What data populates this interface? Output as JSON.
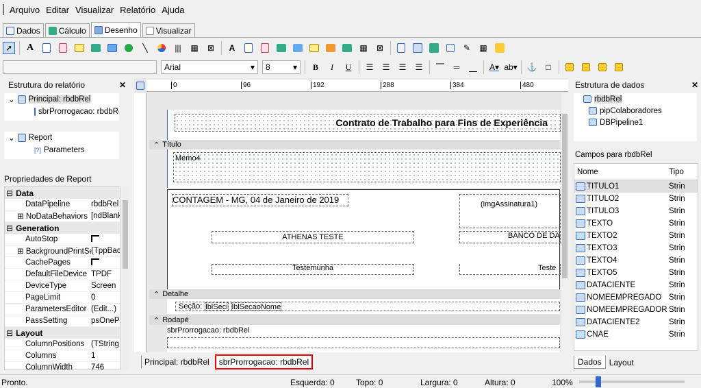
{
  "menu": [
    "Arquivo",
    "Editar",
    "Visualizar",
    "Relatório",
    "Ajuda"
  ],
  "tabs": [
    "Dados",
    "Cálculo",
    "Desenho",
    "Visualizar"
  ],
  "font": {
    "name": "Arial",
    "size": "8"
  },
  "ruler": [
    "0",
    "96",
    "192",
    "288",
    "384",
    "480"
  ],
  "left_panel": {
    "title": "Estrutura do relatório",
    "tree1": [
      "Principal: rbdbRel",
      "sbrProrrogacao: rbdbRe"
    ],
    "tree2": [
      "Report",
      "Parameters"
    ]
  },
  "props": {
    "title": "Propriedades de Report",
    "rows": [
      {
        "cat": "Data"
      },
      {
        "k": "DataPipeline",
        "v": "rbdbRel"
      },
      {
        "k": "NoDataBehaviors",
        "v": "[ndBlank",
        "exp": true
      },
      {
        "cat": "Generation"
      },
      {
        "k": "AutoStop",
        "v": "",
        "check": true
      },
      {
        "k": "BackgroundPrintSe",
        "v": "(TppBac",
        "exp": true
      },
      {
        "k": "CachePages",
        "v": "",
        "check": true
      },
      {
        "k": "DefaultFileDevice",
        "v": "TPDF"
      },
      {
        "k": "DeviceType",
        "v": "Screen"
      },
      {
        "k": "PageLimit",
        "v": "0"
      },
      {
        "k": "ParametersEditor",
        "v": "(Edit...)"
      },
      {
        "k": "PassSetting",
        "v": "psOneP"
      },
      {
        "cat": "Layout"
      },
      {
        "k": "ColumnPositions",
        "v": "(TString"
      },
      {
        "k": "Columns",
        "v": "1"
      },
      {
        "k": "ColumnWidth",
        "v": "746"
      }
    ]
  },
  "report": {
    "title": "Contrato de Trabalho para Fins de Experiência",
    "band_titulo": "Título",
    "memo": "Memo4",
    "date": "CONTAGEM - MG, 04 de Janeiro de 2019",
    "img": "(imgAssinatura1)",
    "company": "ATHENAS TESTE",
    "bank": "BANCO DE DA",
    "witness": "Testemunha",
    "witness2": "Teste",
    "band_detalhe": "Detalhe",
    "secao": "Seção:",
    "lbl1": "lblSeci",
    "lbl2": "lblSecaoNome",
    "band_rodape": "Rodapé",
    "sub": "sbrProrrogacao: rbdbRel"
  },
  "bottom_tabs": [
    "Principal: rbdbRel",
    "sbrProrrogacao: rbdbRel"
  ],
  "right": {
    "title": "Estrutura de dados",
    "tree": [
      "rbdbRel",
      "pipColaboradores",
      "DBPipeline1"
    ],
    "fields_title": "Campos para rbdbRel",
    "col_name": "Nome",
    "col_type": "Tipo",
    "fields": [
      "TITULO1",
      "TITULO2",
      "TITULO3",
      "TEXTO",
      "TEXTO2",
      "TEXTO3",
      "TEXTO4",
      "TEXTO5",
      "DATACIENTE",
      "NOMEEMPREGADO",
      "NOMEEMPREGADOR",
      "DATACIENTE2",
      "CNAE"
    ],
    "type": "Strin",
    "tabs": [
      "Dados",
      "Layout"
    ]
  },
  "status": {
    "ready": "Pronto.",
    "left": "Esquerda: 0",
    "top": "Topo: 0",
    "width": "Largura: 0",
    "height": "Altura: 0",
    "zoom": "100%"
  }
}
